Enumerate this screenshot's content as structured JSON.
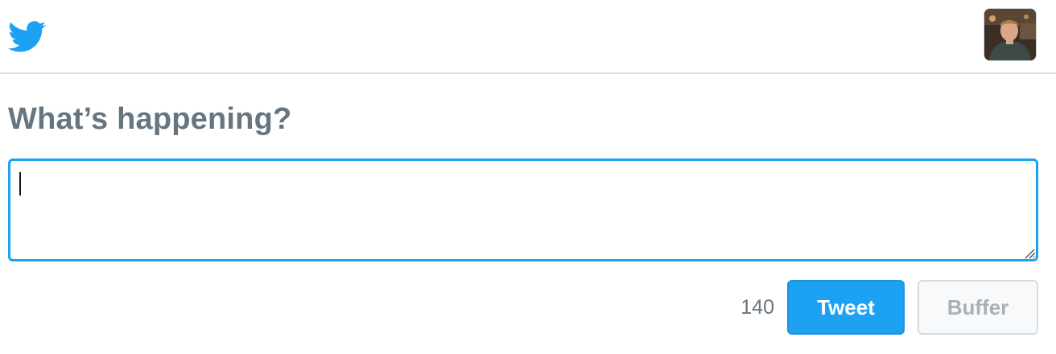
{
  "header": {
    "logo_icon": "twitter-bird-icon",
    "avatar_icon": "user-avatar",
    "brand_color": "#1da1f2"
  },
  "compose": {
    "heading": "What’s happening?",
    "input_value": "",
    "char_counter": "140"
  },
  "actions": {
    "tweet_label": "Tweet",
    "buffer_label": "Buffer"
  }
}
